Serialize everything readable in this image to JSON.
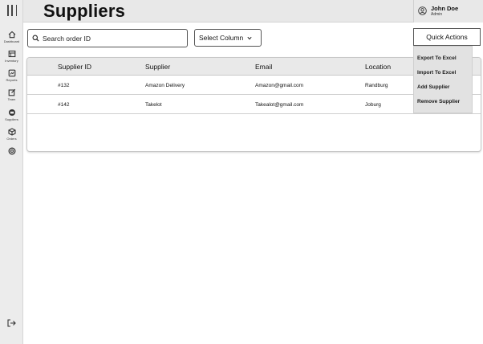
{
  "sidebar": {
    "items": [
      {
        "label": "Dashboard",
        "icon": "home-icon"
      },
      {
        "label": "Inventory",
        "icon": "inventory-icon"
      },
      {
        "label": "Reports",
        "icon": "reports-icon"
      },
      {
        "label": "Team",
        "icon": "team-icon"
      },
      {
        "label": "Suppliers",
        "icon": "suppliers-icon"
      },
      {
        "label": "Orders",
        "icon": "orders-icon"
      },
      {
        "label": "",
        "icon": "settings-icon"
      }
    ],
    "logout_icon": "logout-icon"
  },
  "header": {
    "title": "Suppliers",
    "user": {
      "name": "John Doe",
      "role": "Admin"
    }
  },
  "toolbar": {
    "search_placeholder": "Search order ID",
    "select_label": "Select Column",
    "quick_actions_label": "Quick Actions"
  },
  "quick_actions_menu": {
    "items": [
      "Export To Excel",
      "Import To Excel",
      "Add Supplier",
      "Remove Supplier"
    ]
  },
  "table": {
    "columns": [
      "Supplier ID",
      "Supplier",
      "Email",
      "Location"
    ],
    "rows": [
      [
        "#132",
        "Amazon Delivery",
        "Amazon@gmail.com",
        "Randburg"
      ],
      [
        "#142",
        "Takelot",
        "Takealot@gmail.com",
        "Joburg"
      ]
    ]
  }
}
